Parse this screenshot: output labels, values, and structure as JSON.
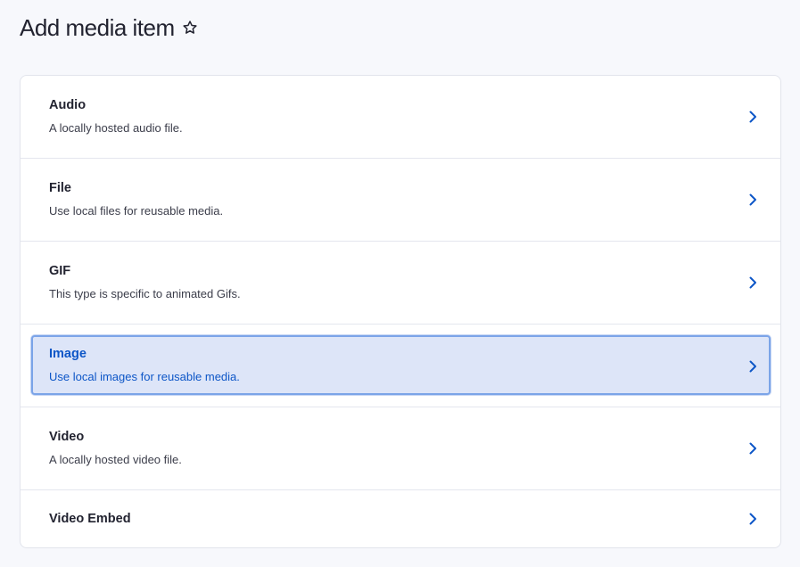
{
  "page": {
    "title": "Add media item"
  },
  "icons": {
    "favorite": "star-outline-icon",
    "chevron": "chevron-right-icon"
  },
  "colors": {
    "accent": "#0d56c7",
    "highlight_bg": "#dde5f8",
    "highlight_border": "#7ba4e8"
  },
  "media_types": [
    {
      "label": "Audio",
      "description": "A locally hosted audio file.",
      "selected": false
    },
    {
      "label": "File",
      "description": "Use local files for reusable media.",
      "selected": false
    },
    {
      "label": "GIF",
      "description": "This type is specific to animated Gifs.",
      "selected": false
    },
    {
      "label": "Image",
      "description": "Use local images for reusable media.",
      "selected": true
    },
    {
      "label": "Video",
      "description": "A locally hosted video file.",
      "selected": false
    },
    {
      "label": "Video Embed",
      "description": "",
      "selected": false
    }
  ]
}
